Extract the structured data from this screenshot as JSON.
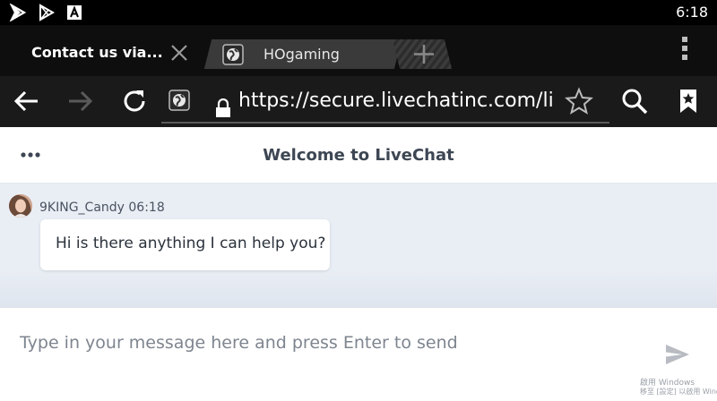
{
  "status_bar": {
    "time": "6:18",
    "icons": [
      "notification-flag-icon",
      "play-store-icon",
      "android-app-icon"
    ]
  },
  "tabs": [
    {
      "title": "Contact us via...",
      "active": true,
      "favicon": "close-icon"
    },
    {
      "title": "HOgaming",
      "active": false,
      "favicon": "globe-icon"
    }
  ],
  "toolbar": {
    "url": "https://secure.livechatinc.com/lice",
    "icons": [
      "back-arrow-icon",
      "forward-arrow-icon",
      "refresh-icon",
      "globe-icon",
      "lock-icon",
      "star-icon",
      "search-icon",
      "bookmark-icon"
    ]
  },
  "chat": {
    "header_title": "Welcome to LiveChat",
    "message": {
      "author": "9KING_Candy",
      "time": "06:18",
      "meta": "9KING_Candy 06:18",
      "text": "Hi is there anything I can help you?"
    },
    "input_placeholder": "Type in your message here and press Enter to send"
  },
  "watermark": {
    "line1": "啟用 Windows",
    "line2": "移至 [設定] 以啟用 Windo"
  },
  "colors": {
    "status_bar": "#000000",
    "tab_strip": "#0e0e0e",
    "toolbar": "#1a1a1a",
    "chat_area": "#e9eef5",
    "header_text": "#3d4653"
  }
}
